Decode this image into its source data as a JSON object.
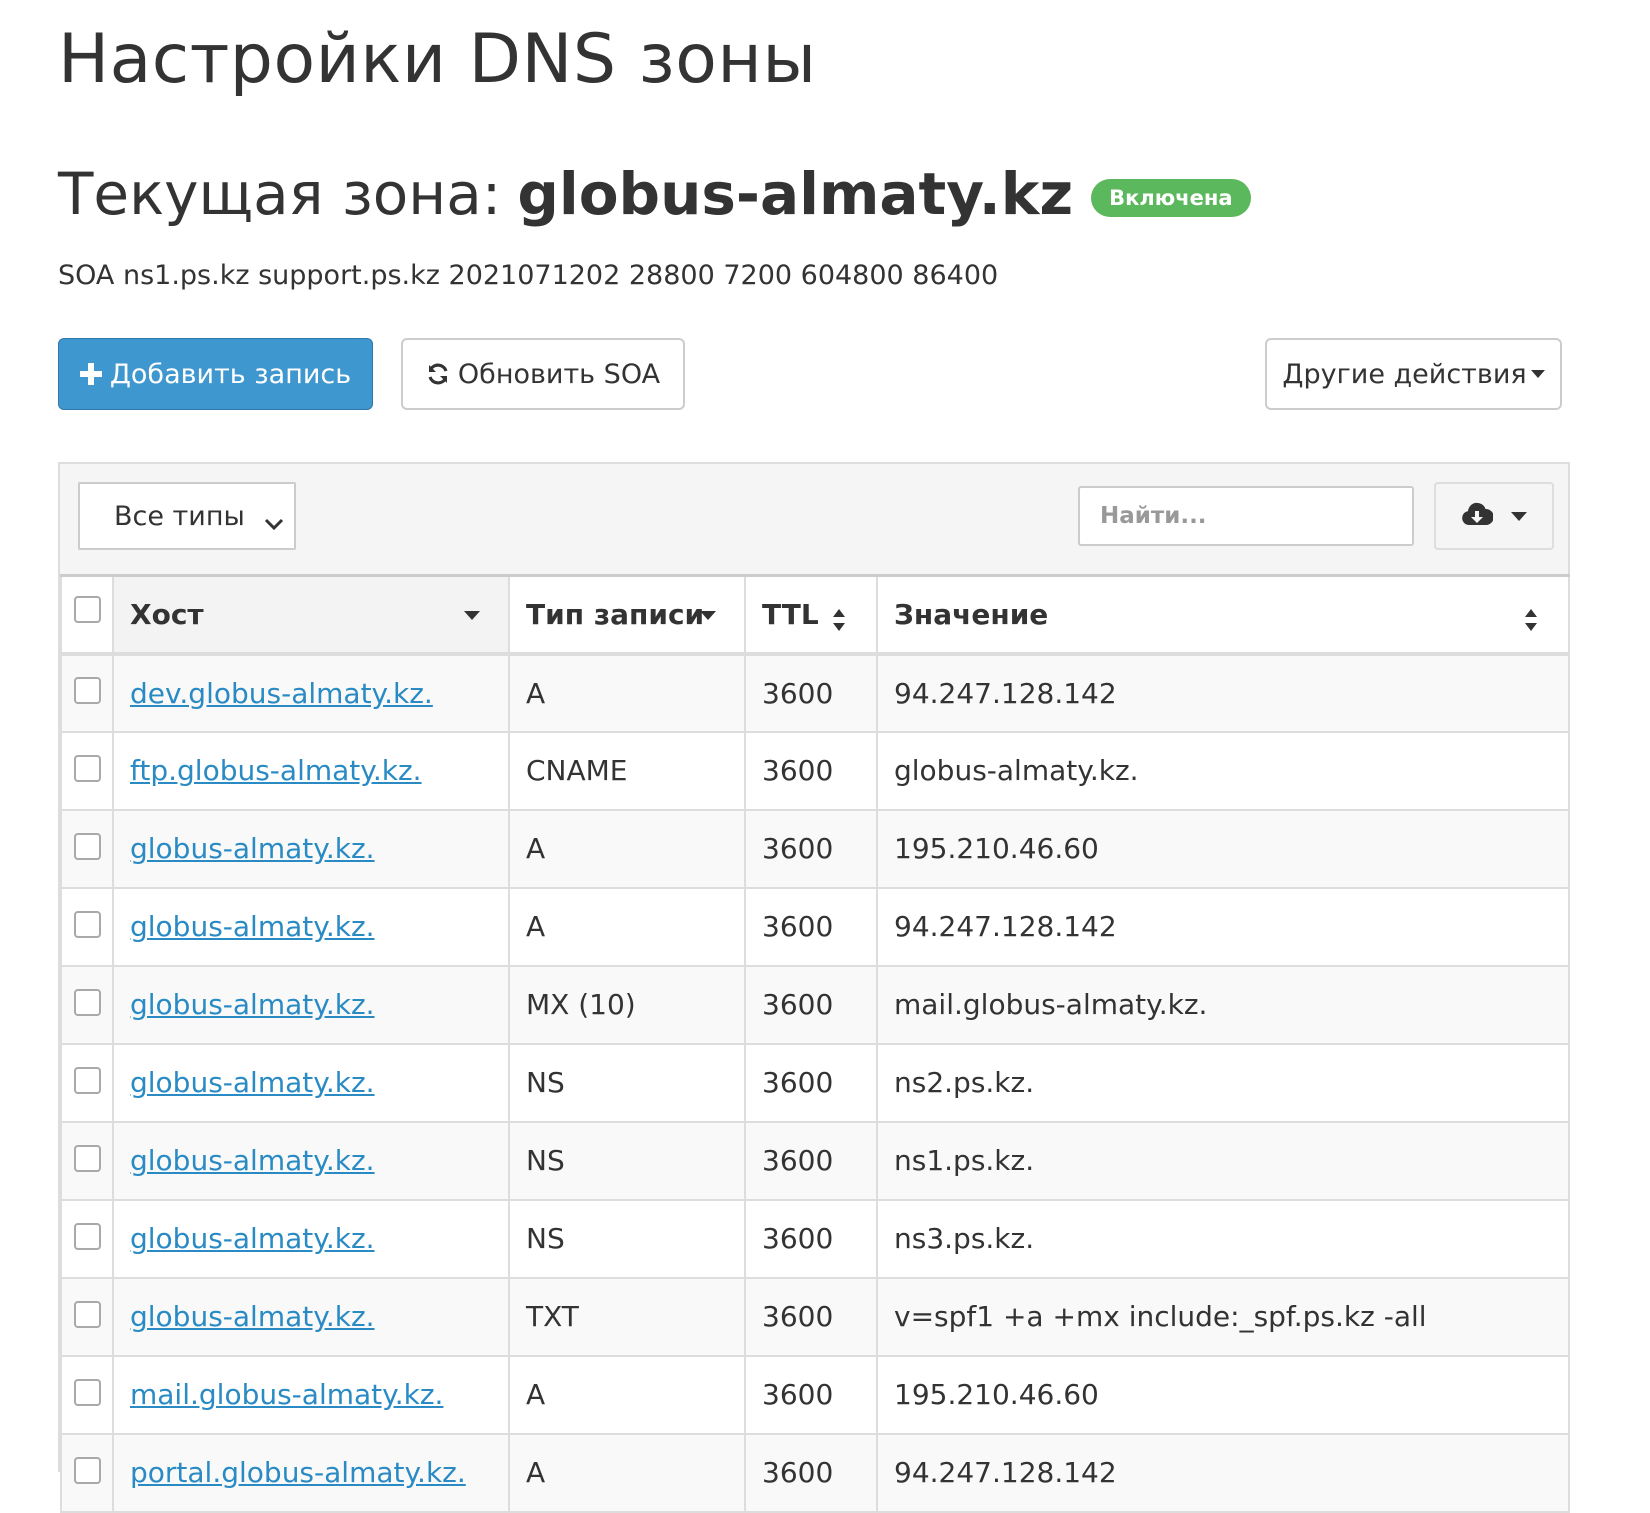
{
  "page": {
    "title": "Настройки DNS зоны"
  },
  "zone": {
    "label": "Текущая зона:",
    "name": "globus-almaty.kz",
    "status": "Включена",
    "soa": "SOA ns1.ps.kz support.ps.kz 2021071202 28800 7200 604800 86400"
  },
  "actions": {
    "add_record": "Добавить запись",
    "refresh_soa": "Обновить SOA",
    "other_actions": "Другие действия"
  },
  "toolbar": {
    "type_filter": "Все типы",
    "search_placeholder": "Найти...",
    "export_icon": "cloud-download-icon"
  },
  "table": {
    "columns": [
      "Хост",
      "Тип записи",
      "TTL",
      "Значение"
    ],
    "rows": [
      {
        "host": "dev.globus-almaty.kz.",
        "type": "A",
        "ttl": "3600",
        "value": "94.247.128.142"
      },
      {
        "host": "ftp.globus-almaty.kz.",
        "type": "CNAME",
        "ttl": "3600",
        "value": "globus-almaty.kz."
      },
      {
        "host": "globus-almaty.kz.",
        "type": "A",
        "ttl": "3600",
        "value": "195.210.46.60"
      },
      {
        "host": "globus-almaty.kz.",
        "type": "A",
        "ttl": "3600",
        "value": "94.247.128.142"
      },
      {
        "host": "globus-almaty.kz.",
        "type": "MX (10)",
        "ttl": "3600",
        "value": "mail.globus-almaty.kz."
      },
      {
        "host": "globus-almaty.kz.",
        "type": "NS",
        "ttl": "3600",
        "value": "ns2.ps.kz."
      },
      {
        "host": "globus-almaty.kz.",
        "type": "NS",
        "ttl": "3600",
        "value": "ns1.ps.kz."
      },
      {
        "host": "globus-almaty.kz.",
        "type": "NS",
        "ttl": "3600",
        "value": "ns3.ps.kz."
      },
      {
        "host": "globus-almaty.kz.",
        "type": "TXT",
        "ttl": "3600",
        "value": "v=spf1 +a +mx include:_spf.ps.kz -all"
      },
      {
        "host": "mail.globus-almaty.kz.",
        "type": "A",
        "ttl": "3600",
        "value": "195.210.46.60"
      },
      {
        "host": "portal.globus-almaty.kz.",
        "type": "A",
        "ttl": "3600",
        "value": "94.247.128.142"
      }
    ]
  },
  "colors": {
    "primary": "#3f97cf",
    "link": "#2a8bc4",
    "badge_success": "#5cb85c"
  }
}
